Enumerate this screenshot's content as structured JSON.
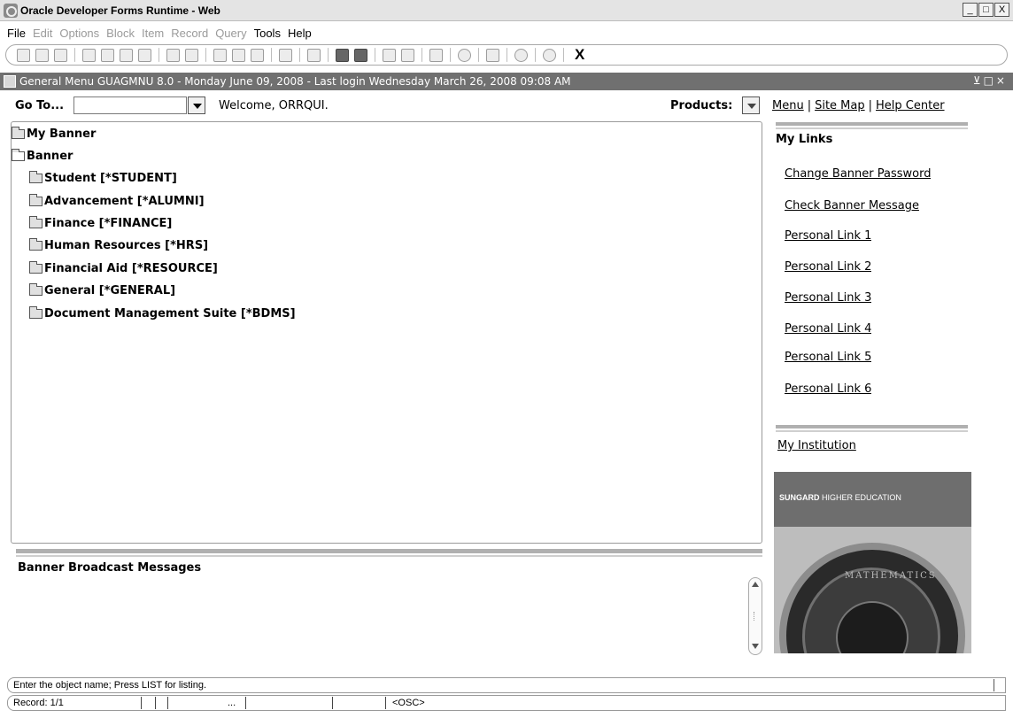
{
  "window": {
    "title": "Oracle Developer Forms Runtime - Web",
    "controls": [
      "_",
      "□",
      "X"
    ]
  },
  "menubar": [
    {
      "label": "File",
      "enabled": true
    },
    {
      "label": "Edit",
      "enabled": false
    },
    {
      "label": "Options",
      "enabled": false
    },
    {
      "label": "Block",
      "enabled": false
    },
    {
      "label": "Item",
      "enabled": false
    },
    {
      "label": "Record",
      "enabled": false
    },
    {
      "label": "Query",
      "enabled": false
    },
    {
      "label": "Tools",
      "enabled": true
    },
    {
      "label": "Help",
      "enabled": true
    }
  ],
  "toolbar": {
    "exit_label": "X"
  },
  "form": {
    "title": "General Menu  GUAGMNU  8.0 - Monday June 09, 2008 - Last login Wednesday March 26, 2008 09:08 AM",
    "goto_label": "Go To...",
    "goto_value": "",
    "welcome": "Welcome, ORRQUI.",
    "products_label": "Products:"
  },
  "toplinks": {
    "menu": "Menu",
    "sitemap": "Site Map",
    "help": "Help Center"
  },
  "tree": [
    {
      "label": "My Banner"
    },
    {
      "label": "Banner"
    },
    {
      "label": "Student [*STUDENT]"
    },
    {
      "label": "Advancement [*ALUMNI]"
    },
    {
      "label": "Finance [*FINANCE]"
    },
    {
      "label": "Human Resources [*HRS]"
    },
    {
      "label": "Financial Aid [*RESOURCE]"
    },
    {
      "label": "General [*GENERAL]"
    },
    {
      "label": "Document Management Suite [*BDMS]"
    }
  ],
  "broadcast": {
    "title": "Banner Broadcast Messages"
  },
  "mylinks": {
    "title": "My Links",
    "links": [
      "Change Banner Password",
      "Check Banner Message",
      "Personal Link 1",
      "Personal Link 2",
      "Personal Link 3",
      "Personal Link 4",
      "Personal Link 5",
      "Personal Link 6"
    ]
  },
  "institution": {
    "link": "My Institution",
    "brand_bold": "SUNGARD",
    "brand_rest": " HIGHER EDUCATION",
    "engraving": "MATHEMATICS"
  },
  "status": {
    "message": "Enter the object name; Press LIST for listing.",
    "record": "Record: 1/1",
    "ellipsis": "...",
    "osc": "<OSC>"
  }
}
